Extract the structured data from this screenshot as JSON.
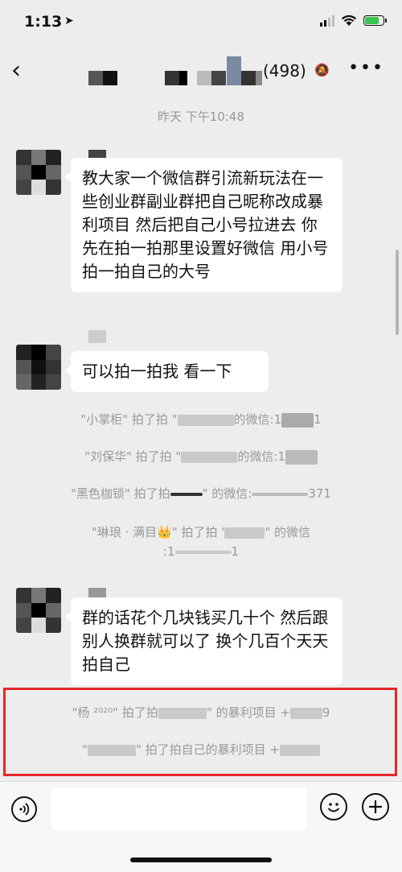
{
  "status": {
    "time": "1:13",
    "location_icon": "location-arrow-icon"
  },
  "nav": {
    "back": "‹",
    "title_count": "(498)",
    "mute_icon": "bell-off-icon",
    "more": "•••"
  },
  "chat": {
    "time_separator": "昨天 下午10:48",
    "msg1": "教大家一个微信群引流新玩法在一些创业群副业群把自己昵称改成暴利项目 然后把自己小号拉进去 你先在拍一拍那里设置好微信 用小号拍一拍自己的大号",
    "msg2": "可以拍一拍我 看一下",
    "msg3": "群的话花个几块钱买几十个 然后跟别人换群就可以了 换个几百个天天拍自己"
  },
  "system": {
    "s1_a": "\"小掌柜\" 拍了拍 \"",
    "s1_b": "的微信:1",
    "s1_c": "1",
    "s2_a": "\"刘保华\" 拍了拍 \"",
    "s2_b": "的微信:1",
    "s3_a": "\"黑色枷锁\" 拍了拍",
    "s3_b": "\" 的微信:",
    "s3_c": "371",
    "s4_a": "\"琳琅 · 满目",
    "s4_crown": "👑",
    "s4_b": "\" 拍了拍 '",
    "s4_c": "\" 的微信",
    "s4_d": ":1",
    "s4_e": "1",
    "s5_a": "\"杨 ²⁰²⁰\" 拍了拍",
    "s5_b": "\" 的暴利项目 +",
    "s5_c": "9",
    "s6_a": "\"",
    "s6_b": "\" 拍了拍自己的暴利项目 +"
  },
  "colors": {
    "highlight": "#e8262b",
    "background": "#ededed"
  }
}
